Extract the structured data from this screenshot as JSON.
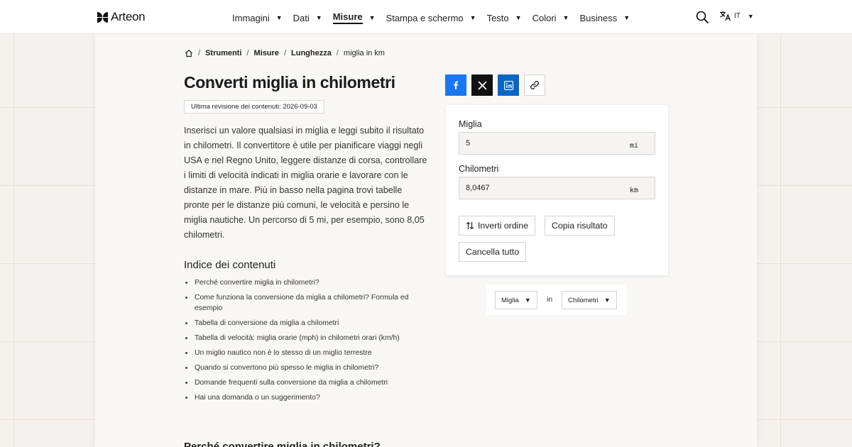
{
  "brand": {
    "name": "Arteon"
  },
  "nav": {
    "items": [
      {
        "label": "Immagini"
      },
      {
        "label": "Dati"
      },
      {
        "label": "Misure"
      },
      {
        "label": "Stampa e schermo"
      },
      {
        "label": "Testo"
      },
      {
        "label": "Colori"
      },
      {
        "label": "Business"
      }
    ],
    "active": "Misure",
    "language": "IT"
  },
  "breadcrumb": {
    "items": [
      "Strumenti",
      "Misure",
      "Lunghezza"
    ],
    "current": "miglia in km"
  },
  "article": {
    "title": "Converti miglia in chilometri",
    "revision": "Ultima revisione dei contenuti: 2026-09-03",
    "intro": "Inserisci un valore qualsiasi in miglia e leggi subito il risultato in chilometri. Il convertitore è utile per pianificare viaggi negli USA e nel Regno Unito, leggere distanze di corsa, controllare i limiti di velocità indicati in miglia orarie e lavorare con le distanze in mare. Più in basso nella pagina trovi tabelle pronte per le distanze più comuni, le velocità e persino le miglia nautiche. Un percorso di 5 mi, per esempio, sono 8,05 chilometri.",
    "toc_title": "Indice dei contenuti",
    "toc": [
      "Perché convertire miglia in chilometri?",
      "Come funziona la conversione da miglia a chilometri? Formula ed esempio",
      "Tabella di conversione da miglia a chilometri",
      "Tabella di velocità: miglia orarie (mph) in chilometri orari (km/h)",
      "Un miglio nautico non è lo stesso di un miglio terrestre",
      "Quando si convertono più spesso le miglia in chilometri?",
      "Domande frequenti sulla conversione da miglia a chilometri",
      "Hai una domanda o un suggerimento?"
    ],
    "next_heading": "Perché convertire miglia in chilometri?"
  },
  "converter": {
    "from_label": "Miglia",
    "from_value": "5",
    "from_unit": "mi",
    "to_label": "Chilometri",
    "to_value": "8,0467",
    "to_unit": "km",
    "swap_label": "Inverti ordine",
    "copy_label": "Copia risultato",
    "clear_label": "Cancella tutto"
  },
  "unit_picker": {
    "from": "Miglia",
    "in_word": "in",
    "to": "Chilometri"
  },
  "colors": {
    "facebook": "#1877f2",
    "x": "#111111",
    "linkedin": "#0a66c2"
  }
}
